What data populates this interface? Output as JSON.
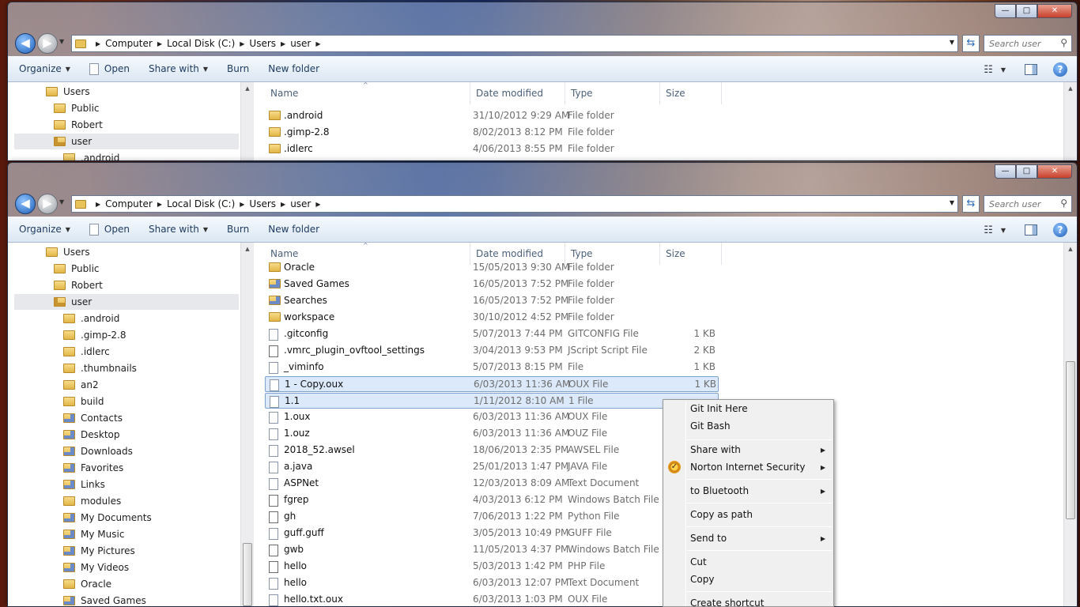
{
  "window": {
    "caption": {
      "minimize": "—",
      "maximize": "□",
      "close": "✕"
    },
    "nav": {
      "back": "◀",
      "forward": "▶"
    },
    "address": {
      "crumbs": [
        "Computer",
        "Local Disk (C:)",
        "Users",
        "user"
      ]
    },
    "search": {
      "placeholder": "Search user"
    },
    "toolbar": {
      "organize": "Organize",
      "open": "Open",
      "share_with": "Share with",
      "burn": "Burn",
      "new_folder": "New folder"
    },
    "columns": {
      "name": "Name",
      "date": "Date modified",
      "type": "Type",
      "size": "Size"
    }
  },
  "top_window": {
    "nav_tree": [
      {
        "label": "Users",
        "icon": "folder-icon"
      },
      {
        "label": "Public",
        "icon": "folder-icon"
      },
      {
        "label": "Robert",
        "icon": "folder-icon"
      },
      {
        "label": "user",
        "icon": "locked-folder-icon",
        "selected": true
      },
      {
        "label": ".android",
        "icon": "folder-icon"
      }
    ],
    "files": [
      {
        "name": ".android",
        "date": "31/10/2012 9:29 AM",
        "type": "File folder",
        "size": ""
      },
      {
        "name": ".gimp-2.8",
        "date": "8/02/2013 8:12 PM",
        "type": "File folder",
        "size": ""
      },
      {
        "name": ".idlerc",
        "date": "4/06/2013 8:55 PM",
        "type": "File folder",
        "size": ""
      }
    ]
  },
  "bottom_window": {
    "nav_tree": [
      {
        "label": "Users",
        "icon": "folder-icon"
      },
      {
        "label": "Public",
        "icon": "folder-icon"
      },
      {
        "label": "Robert",
        "icon": "folder-icon"
      },
      {
        "label": "user",
        "icon": "locked-folder-icon",
        "selected": true
      },
      {
        "label": ".android",
        "icon": "folder-icon"
      },
      {
        "label": ".gimp-2.8",
        "icon": "folder-icon"
      },
      {
        "label": ".idlerc",
        "icon": "folder-icon"
      },
      {
        "label": ".thumbnails",
        "icon": "folder-icon"
      },
      {
        "label": "an2",
        "icon": "folder-icon"
      },
      {
        "label": "build",
        "icon": "folder-icon"
      },
      {
        "label": "Contacts",
        "icon": "contacts-folder-icon"
      },
      {
        "label": "Desktop",
        "icon": "desktop-folder-icon"
      },
      {
        "label": "Downloads",
        "icon": "downloads-folder-icon"
      },
      {
        "label": "Favorites",
        "icon": "favorites-folder-icon"
      },
      {
        "label": "Links",
        "icon": "links-folder-icon"
      },
      {
        "label": "modules",
        "icon": "folder-icon"
      },
      {
        "label": "My Documents",
        "icon": "documents-folder-icon"
      },
      {
        "label": "My Music",
        "icon": "music-folder-icon"
      },
      {
        "label": "My Pictures",
        "icon": "pictures-folder-icon"
      },
      {
        "label": "My Videos",
        "icon": "videos-folder-icon"
      },
      {
        "label": "Oracle",
        "icon": "folder-icon"
      },
      {
        "label": "Saved Games",
        "icon": "saved-games-folder-icon"
      }
    ],
    "files": [
      {
        "name": "Oracle",
        "date": "15/05/2013 9:30 AM",
        "type": "File folder",
        "size": "",
        "icon": "folder-icon"
      },
      {
        "name": "Saved Games",
        "date": "16/05/2013 7:52 PM",
        "type": "File folder",
        "size": "",
        "icon": "saved-games-folder-icon"
      },
      {
        "name": "Searches",
        "date": "16/05/2013 7:52 PM",
        "type": "File folder",
        "size": "",
        "icon": "searches-folder-icon"
      },
      {
        "name": "workspace",
        "date": "30/10/2012 4:52 PM",
        "type": "File folder",
        "size": "",
        "icon": "folder-icon"
      },
      {
        "name": ".gitconfig",
        "date": "5/07/2013 7:44 PM",
        "type": "GITCONFIG File",
        "size": "1 KB",
        "icon": "file-icon"
      },
      {
        "name": ".vmrc_plugin_ovftool_settings",
        "date": "3/04/2013 9:53 PM",
        "type": "JScript Script File",
        "size": "2 KB",
        "icon": "script-icon"
      },
      {
        "name": "_viminfo",
        "date": "5/07/2013 8:15 PM",
        "type": "File",
        "size": "1 KB",
        "icon": "file-icon"
      },
      {
        "name": "1 - Copy.oux",
        "date": "6/03/2013 11:36 AM",
        "type": "OUX File",
        "size": "1 KB",
        "icon": "file-icon",
        "selected": true
      },
      {
        "name": "1.1",
        "date": "1/11/2012 8:10 AM",
        "type": "1 File",
        "size": "",
        "icon": "file-icon",
        "selected": true
      },
      {
        "name": "1.oux",
        "date": "6/03/2013 11:36 AM",
        "type": "OUX File",
        "size": "",
        "icon": "file-icon"
      },
      {
        "name": "1.ouz",
        "date": "6/03/2013 11:36 AM",
        "type": "OUZ File",
        "size": "",
        "icon": "file-icon"
      },
      {
        "name": "2018_52.awsel",
        "date": "18/06/2013 2:35 PM",
        "type": "AWSEL File",
        "size": "",
        "icon": "file-icon"
      },
      {
        "name": "a.java",
        "date": "25/01/2013 1:47 PM",
        "type": "JAVA File",
        "size": "",
        "icon": "file-icon"
      },
      {
        "name": "ASPNet",
        "date": "12/03/2013 8:09 AM",
        "type": "Text Document",
        "size": "",
        "icon": "text-file-icon"
      },
      {
        "name": "fgrep",
        "date": "4/03/2013 6:12 PM",
        "type": "Windows Batch File",
        "size": "",
        "icon": "batch-file-icon"
      },
      {
        "name": "gh",
        "date": "7/06/2013 1:22 PM",
        "type": "Python File",
        "size": "",
        "icon": "python-file-icon"
      },
      {
        "name": "guff.guff",
        "date": "3/05/2013 10:49 PM",
        "type": "GUFF File",
        "size": "",
        "icon": "file-icon"
      },
      {
        "name": "gwb",
        "date": "11/05/2013 4:37 PM",
        "type": "Windows Batch File",
        "size": "",
        "icon": "batch-file-icon"
      },
      {
        "name": "hello",
        "date": "5/03/2013 1:42 PM",
        "type": "PHP File",
        "size": "",
        "icon": "php-file-icon"
      },
      {
        "name": "hello",
        "date": "6/03/2013 12:07 PM",
        "type": "Text Document",
        "size": "",
        "icon": "text-file-icon"
      },
      {
        "name": "hello.txt.oux",
        "date": "6/03/2013 1:03 PM",
        "type": "OUX File",
        "size": "",
        "icon": "file-icon"
      }
    ]
  },
  "context_menu": {
    "items": [
      {
        "label": "Git Init Here",
        "submenu": false
      },
      {
        "label": "Git Bash",
        "submenu": false
      },
      {
        "label": "Share with",
        "submenu": true
      },
      {
        "label": "Norton Internet Security",
        "submenu": true,
        "icon": "norton-icon"
      },
      {
        "label": "to Bluetooth",
        "submenu": true
      },
      {
        "label": "Copy as path",
        "submenu": false
      },
      {
        "label": "Send to",
        "submenu": true
      },
      {
        "label": "Cut",
        "submenu": false
      },
      {
        "label": "Copy",
        "submenu": false
      },
      {
        "label": "Create shortcut",
        "submenu": false
      }
    ]
  }
}
